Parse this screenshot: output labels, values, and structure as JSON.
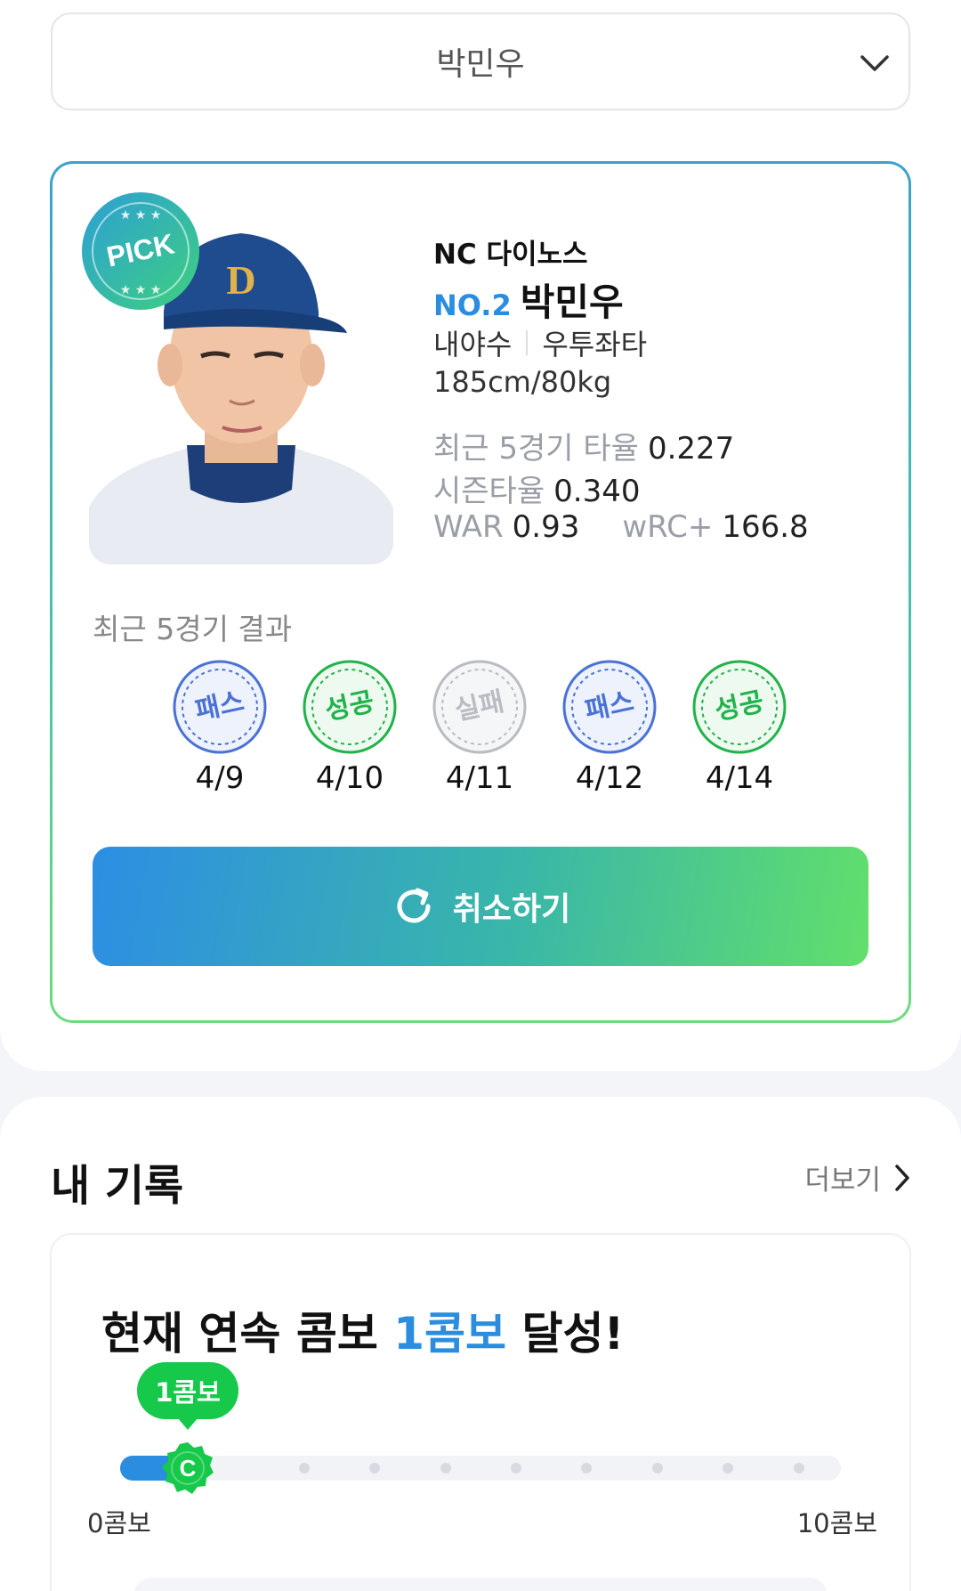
{
  "player_select": {
    "value": "박민우",
    "icon": "chevron-down-icon"
  },
  "player_card": {
    "badge": "PICK",
    "team": "NC 다이노스",
    "number": "NO.2",
    "name": "박민우",
    "position": "내야수",
    "bats_throws": "우투좌타",
    "physical": "185cm/80kg",
    "stats": {
      "recent5_label": "최근 5경기 타율",
      "recent5_value": "0.227",
      "season_label": "시즌타율",
      "season_value": "0.340",
      "war_label": "WAR",
      "war_value": "0.93",
      "wrc_label": "wRC+",
      "wrc_value": "166.8"
    },
    "recent_results_title": "최근 5경기 결과",
    "recent_results": [
      {
        "result": "패스",
        "date": "4/9",
        "color": "#4a72d6"
      },
      {
        "result": "성공",
        "date": "4/10",
        "color": "#21b34a"
      },
      {
        "result": "실패",
        "date": "4/11",
        "color": "#b9bcc2"
      },
      {
        "result": "패스",
        "date": "4/12",
        "color": "#4a72d6"
      },
      {
        "result": "성공",
        "date": "4/14",
        "color": "#21b34a"
      }
    ],
    "cancel_button": {
      "label": "취소하기",
      "icon": "refresh-icon"
    }
  },
  "my_record": {
    "title": "내 기록",
    "more_label": "더보기",
    "combo_head_prefix": "현재 연속 콤보 ",
    "combo_head_value": "1콤보",
    "combo_head_suffix": " 달성!",
    "combo_current_label": "1콤보",
    "combo_min": "0콤보",
    "combo_max": "10콤보",
    "combo_current": 1,
    "combo_total": 10
  },
  "colors": {
    "accent_blue": "#2a8de0",
    "accent_green": "#16c94a"
  }
}
